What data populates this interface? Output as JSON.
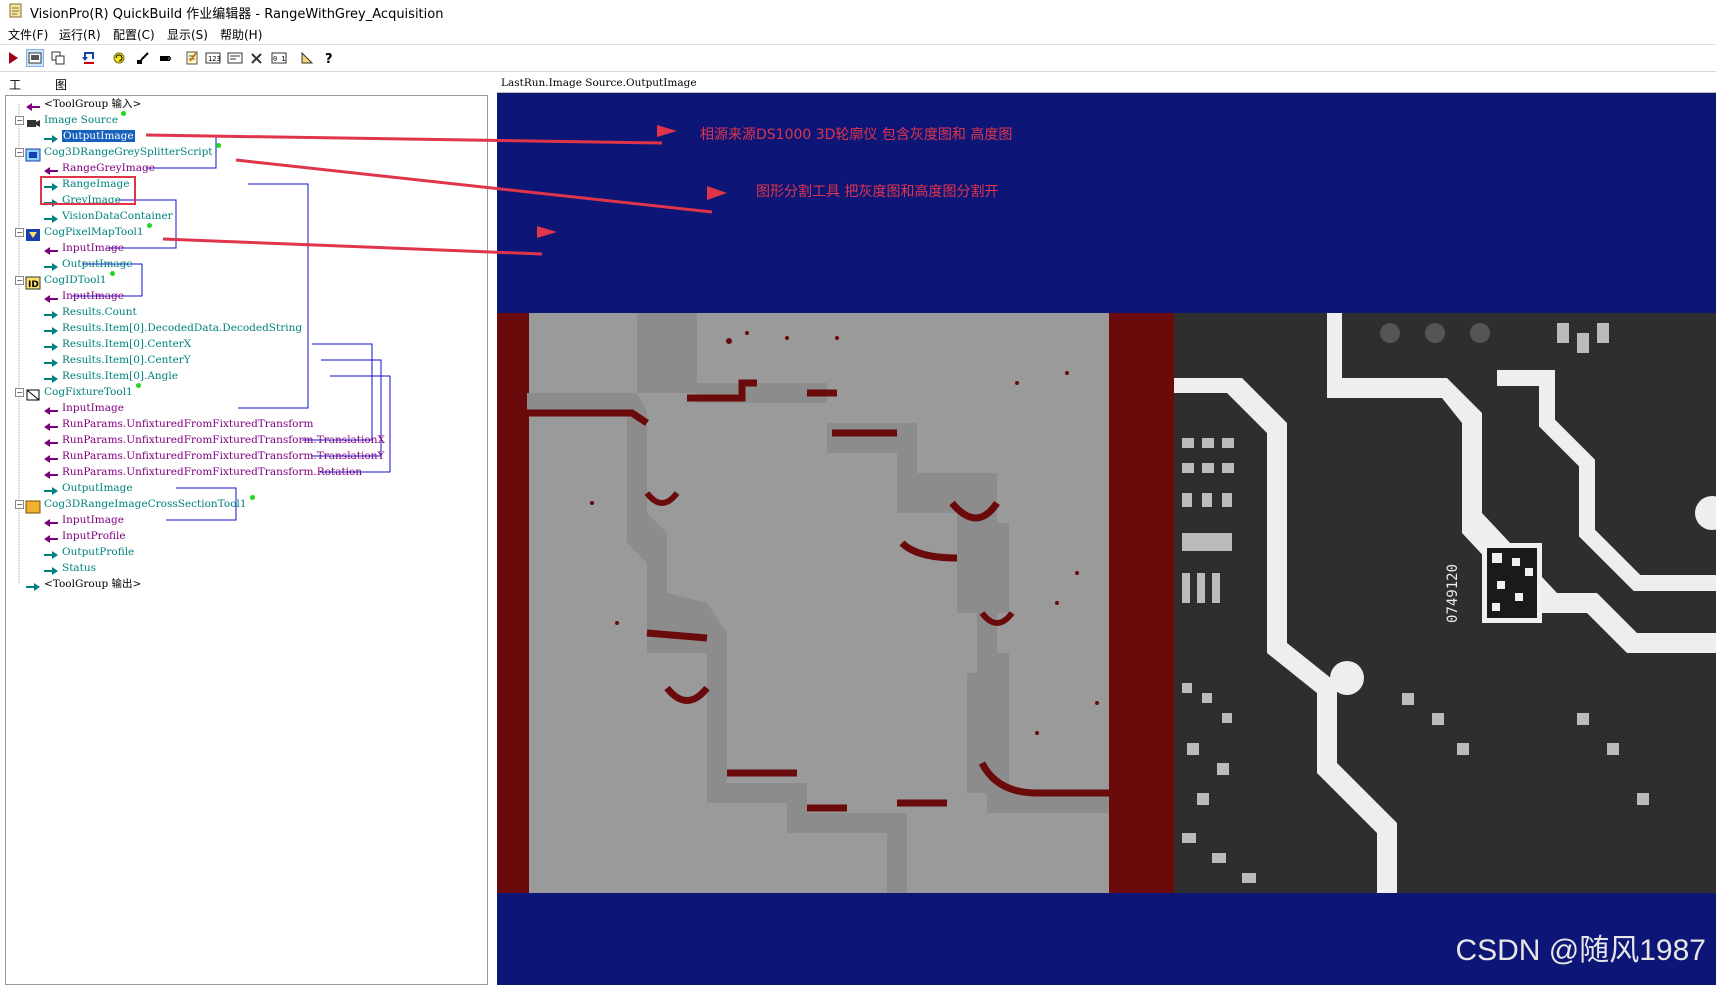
{
  "window": {
    "title": "VisionPro(R) QuickBuild 作业编辑器 - RangeWithGrey_Acquisition"
  },
  "menu": [
    "文件(F)",
    "运行(R)",
    "配置(C)",
    "显示(S)",
    "帮助(H)"
  ],
  "toolbar": {
    "buttons": [
      "run-icon",
      "image-display-icon",
      "copy-windows-icon",
      "reset-icon",
      "loop-icon",
      "brush-icon",
      "record-icon",
      "notepad-icon",
      "numeric-icon",
      "form-icon",
      "tools-icon",
      "binary-icon",
      "ruler-icon",
      "help-icon"
    ]
  },
  "tabs": [
    "工具",
    "图形"
  ],
  "tree": [
    {
      "text": "<ToolGroup 输入>",
      "color": "black",
      "indent": 0,
      "icon": "input-arrow-icon"
    },
    {
      "text": "Image Source",
      "color": "teal",
      "indent": 0,
      "icon": "camera-icon",
      "dot": true
    },
    {
      "text": "OutputImage",
      "color": "selected",
      "indent": 1,
      "icon": "output-arrow-icon"
    },
    {
      "text": "Cog3DRangeGreySplitterScript",
      "color": "teal",
      "indent": 0,
      "icon": "script-tool-icon",
      "dot": true
    },
    {
      "text": "RangeGreyImage",
      "color": "purple",
      "indent": 1,
      "icon": "input-arrow-icon"
    },
    {
      "text": "RangeImage",
      "color": "teal",
      "indent": 1,
      "icon": "output-arrow-icon"
    },
    {
      "text": "GreyImage",
      "color": "teal",
      "indent": 1,
      "icon": "output-arrow-icon"
    },
    {
      "text": "VisionDataContainer",
      "color": "teal",
      "indent": 1,
      "icon": "output-arrow-icon"
    },
    {
      "text": "CogPixelMapTool1",
      "color": "teal",
      "indent": 0,
      "icon": "pixelmap-tool-icon",
      "dot": true
    },
    {
      "text": "InputImage",
      "color": "purple",
      "indent": 1,
      "icon": "input-arrow-icon"
    },
    {
      "text": "OutputImage",
      "color": "teal",
      "indent": 1,
      "icon": "output-arrow-icon"
    },
    {
      "text": "CogIDTool1",
      "color": "teal",
      "indent": 0,
      "icon": "id-tool-icon",
      "dot": true
    },
    {
      "text": "InputImage",
      "color": "purple",
      "indent": 1,
      "icon": "input-arrow-icon"
    },
    {
      "text": "Results.Count",
      "color": "teal",
      "indent": 1,
      "icon": "output-arrow-icon"
    },
    {
      "text": "Results.Item[0].DecodedData.DecodedString",
      "color": "teal",
      "indent": 1,
      "icon": "output-arrow-icon"
    },
    {
      "text": "Results.Item[0].CenterX",
      "color": "teal",
      "indent": 1,
      "icon": "output-arrow-icon"
    },
    {
      "text": "Results.Item[0].CenterY",
      "color": "teal",
      "indent": 1,
      "icon": "output-arrow-icon"
    },
    {
      "text": "Results.Item[0].Angle",
      "color": "teal",
      "indent": 1,
      "icon": "output-arrow-icon"
    },
    {
      "text": "CogFixtureTool1",
      "color": "teal",
      "indent": 0,
      "icon": "fixture-tool-icon",
      "dot": true
    },
    {
      "text": "InputImage",
      "color": "purple",
      "indent": 1,
      "icon": "input-arrow-icon"
    },
    {
      "text": "RunParams.UnfixturedFromFixturedTransform",
      "color": "purple",
      "indent": 1,
      "icon": "input-arrow-icon"
    },
    {
      "text": "RunParams.UnfixturedFromFixturedTransform.TranslationX",
      "color": "purple",
      "indent": 1,
      "icon": "input-arrow-icon"
    },
    {
      "text": "RunParams.UnfixturedFromFixturedTransform.TranslationY",
      "color": "purple",
      "indent": 1,
      "icon": "input-arrow-icon"
    },
    {
      "text": "RunParams.UnfixturedFromFixturedTransform.Rotation",
      "color": "purple",
      "indent": 1,
      "icon": "input-arrow-icon"
    },
    {
      "text": "OutputImage",
      "color": "teal",
      "indent": 1,
      "icon": "output-arrow-icon"
    },
    {
      "text": "Cog3DRangeImageCrossSectionTool1",
      "color": "teal",
      "indent": 0,
      "icon": "crosssection-tool-icon",
      "dot": true
    },
    {
      "text": "InputImage",
      "color": "purple",
      "indent": 1,
      "icon": "input-arrow-icon"
    },
    {
      "text": "InputProfile",
      "color": "purple",
      "indent": 1,
      "icon": "input-arrow-icon"
    },
    {
      "text": "OutputProfile",
      "color": "teal",
      "indent": 1,
      "icon": "output-arrow-icon"
    },
    {
      "text": "Status",
      "color": "teal",
      "indent": 1,
      "icon": "output-arrow-icon"
    },
    {
      "text": "<ToolGroup 输出>",
      "color": "black",
      "indent": 0,
      "icon": "output-arrow-icon"
    }
  ],
  "image_view": {
    "header": "LastRun.Image Source.OutputImage",
    "annotations": [
      "相源来源DS1000 3D轮廓仪 包含灰度图和 高度图",
      "图形分割工具 把灰度图和高度图分割开"
    ],
    "pcb_marking": "0749120",
    "watermark": "CSDN @随风1987"
  },
  "colors": {
    "display_background": "#0d1677",
    "height_map_grey": "#9a9a9a",
    "height_map_shadow": "#6b0a0a",
    "annotation_red": "#e0344a",
    "tree_teal": "#008080",
    "tree_purple": "#800080",
    "link_line_blue": "#1010d0"
  }
}
